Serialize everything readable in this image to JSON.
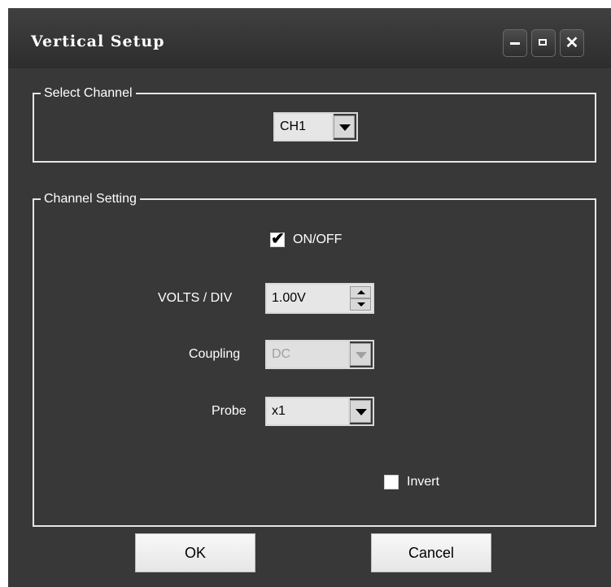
{
  "window": {
    "title": "Vertical Setup",
    "controls": {
      "minimize": "minimize",
      "maximize": "maximize",
      "close": "close"
    }
  },
  "select_channel": {
    "label": "Select Channel",
    "channel": "CH1"
  },
  "channel_setting": {
    "label": "Channel Setting",
    "onoff": {
      "label": "ON/OFF",
      "checked": true
    },
    "volts_div": {
      "label": "VOLTS / DIV",
      "value": "1.00V"
    },
    "coupling": {
      "label": "Coupling",
      "value": "DC",
      "disabled": true
    },
    "probe": {
      "label": "Probe",
      "value": "x1"
    },
    "invert": {
      "label": "Invert",
      "checked": false
    }
  },
  "footer": {
    "ok": "OK",
    "cancel": "Cancel"
  },
  "colors": {
    "background": "#383838",
    "text": "#ffffff",
    "field": "#e6e6e6"
  }
}
